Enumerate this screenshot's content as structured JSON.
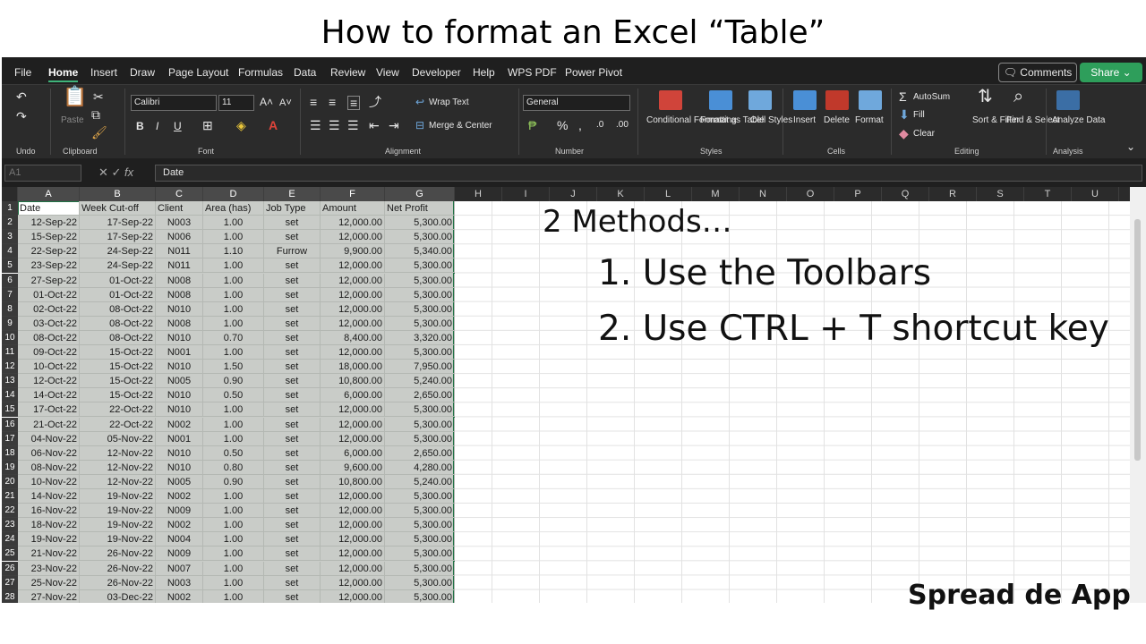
{
  "slide": {
    "title": "How to format an Excel “Table”",
    "heading": "2 Methods…",
    "method1": "1. Use the Toolbars",
    "method2": "2. Use CTRL + T shortcut key",
    "brand": "Spread de App"
  },
  "menu": {
    "items": [
      "File",
      "Home",
      "Insert",
      "Draw",
      "Page Layout",
      "Formulas",
      "Data",
      "Review",
      "View",
      "Developer",
      "Help",
      "WPS PDF",
      "Power Pivot"
    ],
    "active": "Home",
    "comments_label": "Comments",
    "share_label": "Share"
  },
  "ribbon": {
    "undo_label": "Undo",
    "clipboard_label": "Clipboard",
    "paste_label": "Paste",
    "font_label": "Font",
    "font_name": "Calibri",
    "font_size": "11",
    "alignment_label": "Alignment",
    "wrap_text": "Wrap Text",
    "merge_center": "Merge & Center",
    "number_label": "Number",
    "number_format": "General",
    "styles_label": "Styles",
    "conditional_formatting": "Conditional Formatting",
    "format_as_table": "Format as Table",
    "cell_styles": "Cell Styles",
    "cells_label": "Cells",
    "insert": "Insert",
    "delete": "Delete",
    "format": "Format",
    "editing_label": "Editing",
    "autosum": "AutoSum",
    "fill": "Fill",
    "clear": "Clear",
    "sort_filter": "Sort & Filter",
    "find_select": "Find & Select",
    "analysis_label": "Analysis",
    "analyze_data": "Analyze Data"
  },
  "formula_bar": {
    "name_box": "A1",
    "fx": "fx",
    "content": "Date"
  },
  "columns": [
    "A",
    "B",
    "C",
    "D",
    "E",
    "F",
    "G",
    "H",
    "I",
    "J",
    "K",
    "L",
    "M",
    "N",
    "O",
    "P",
    "Q",
    "R",
    "S",
    "T",
    "U"
  ],
  "table": {
    "headers": [
      "Date",
      "Week Cut-off",
      "Client",
      "Area (has)",
      "Job Type",
      "Amount",
      "Net Profit"
    ],
    "rows": [
      [
        "12-Sep-22",
        "17-Sep-22",
        "N003",
        "1.00",
        "set",
        "12,000.00",
        "5,300.00"
      ],
      [
        "15-Sep-22",
        "17-Sep-22",
        "N006",
        "1.00",
        "set",
        "12,000.00",
        "5,300.00"
      ],
      [
        "22-Sep-22",
        "24-Sep-22",
        "N011",
        "1.10",
        "Furrow",
        "9,900.00",
        "5,340.00"
      ],
      [
        "23-Sep-22",
        "24-Sep-22",
        "N011",
        "1.00",
        "set",
        "12,000.00",
        "5,300.00"
      ],
      [
        "27-Sep-22",
        "01-Oct-22",
        "N008",
        "1.00",
        "set",
        "12,000.00",
        "5,300.00"
      ],
      [
        "01-Oct-22",
        "01-Oct-22",
        "N008",
        "1.00",
        "set",
        "12,000.00",
        "5,300.00"
      ],
      [
        "02-Oct-22",
        "08-Oct-22",
        "N010",
        "1.00",
        "set",
        "12,000.00",
        "5,300.00"
      ],
      [
        "03-Oct-22",
        "08-Oct-22",
        "N008",
        "1.00",
        "set",
        "12,000.00",
        "5,300.00"
      ],
      [
        "08-Oct-22",
        "08-Oct-22",
        "N010",
        "0.70",
        "set",
        "8,400.00",
        "3,320.00"
      ],
      [
        "09-Oct-22",
        "15-Oct-22",
        "N001",
        "1.00",
        "set",
        "12,000.00",
        "5,300.00"
      ],
      [
        "10-Oct-22",
        "15-Oct-22",
        "N010",
        "1.50",
        "set",
        "18,000.00",
        "7,950.00"
      ],
      [
        "12-Oct-22",
        "15-Oct-22",
        "N005",
        "0.90",
        "set",
        "10,800.00",
        "5,240.00"
      ],
      [
        "14-Oct-22",
        "15-Oct-22",
        "N010",
        "0.50",
        "set",
        "6,000.00",
        "2,650.00"
      ],
      [
        "17-Oct-22",
        "22-Oct-22",
        "N010",
        "1.00",
        "set",
        "12,000.00",
        "5,300.00"
      ],
      [
        "21-Oct-22",
        "22-Oct-22",
        "N002",
        "1.00",
        "set",
        "12,000.00",
        "5,300.00"
      ],
      [
        "04-Nov-22",
        "05-Nov-22",
        "N001",
        "1.00",
        "set",
        "12,000.00",
        "5,300.00"
      ],
      [
        "06-Nov-22",
        "12-Nov-22",
        "N010",
        "0.50",
        "set",
        "6,000.00",
        "2,650.00"
      ],
      [
        "08-Nov-22",
        "12-Nov-22",
        "N010",
        "0.80",
        "set",
        "9,600.00",
        "4,280.00"
      ],
      [
        "10-Nov-22",
        "12-Nov-22",
        "N005",
        "0.90",
        "set",
        "10,800.00",
        "5,240.00"
      ],
      [
        "14-Nov-22",
        "19-Nov-22",
        "N002",
        "1.00",
        "set",
        "12,000.00",
        "5,300.00"
      ],
      [
        "16-Nov-22",
        "19-Nov-22",
        "N009",
        "1.00",
        "set",
        "12,000.00",
        "5,300.00"
      ],
      [
        "18-Nov-22",
        "19-Nov-22",
        "N002",
        "1.00",
        "set",
        "12,000.00",
        "5,300.00"
      ],
      [
        "19-Nov-22",
        "19-Nov-22",
        "N004",
        "1.00",
        "set",
        "12,000.00",
        "5,300.00"
      ],
      [
        "21-Nov-22",
        "26-Nov-22",
        "N009",
        "1.00",
        "set",
        "12,000.00",
        "5,300.00"
      ],
      [
        "23-Nov-22",
        "26-Nov-22",
        "N007",
        "1.00",
        "set",
        "12,000.00",
        "5,300.00"
      ],
      [
        "25-Nov-22",
        "26-Nov-22",
        "N003",
        "1.00",
        "set",
        "12,000.00",
        "5,300.00"
      ],
      [
        "27-Nov-22",
        "03-Dec-22",
        "N002",
        "1.00",
        "set",
        "12,000.00",
        "5,300.00"
      ]
    ]
  },
  "colors": {
    "accent": "#217346",
    "share": "#2e9e5b",
    "conditional": "#d0443a",
    "table_icon": "#4a8fd6",
    "delete_icon": "#c0392b"
  }
}
